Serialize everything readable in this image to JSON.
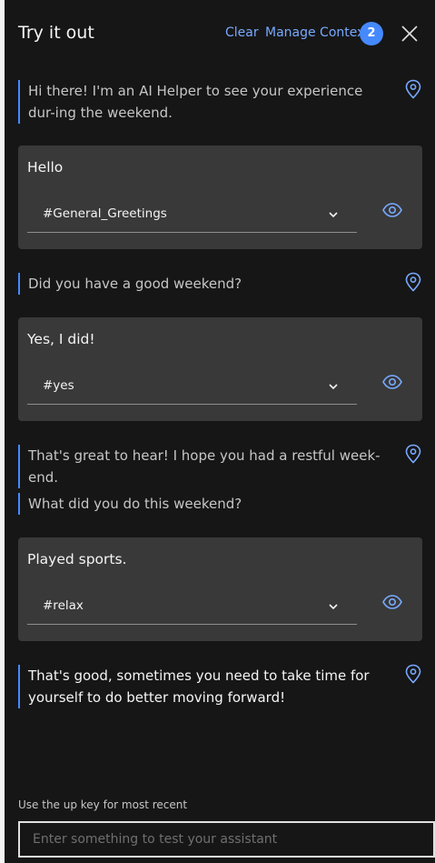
{
  "header": {
    "title": "Try it out",
    "clear_label": "Clear",
    "manage_context_label": "Manage Context",
    "context_count": "2",
    "close_icon": "close-icon"
  },
  "conversation": {
    "bot_1": "Hi there! I'm an AI Helper to see your experience dur-ing the weekend.",
    "user_1": {
      "text": "Hello",
      "intent": "#General_Greetings"
    },
    "bot_2": "Did you have a good weekend?",
    "user_2": {
      "text": "Yes, I did!",
      "intent": "#yes"
    },
    "bot_3": "That's great to hear! I hope you had a restful week-end.",
    "bot_4": "What did you do this weekend?",
    "user_3": {
      "text": "Played sports.",
      "intent": "#relax"
    },
    "bot_5": "That's good, sometimes you need to take time for yourself to do better moving forward!"
  },
  "input": {
    "hint": "Use the up key for most recent",
    "placeholder": "Enter something to test your assistant"
  },
  "icons": {
    "pin": "location-pin-icon",
    "eye": "eye-icon",
    "chevron": "chevron-down-icon"
  },
  "colors": {
    "background": "#161616",
    "card": "#393939",
    "accent": "#4589ff",
    "link": "#78a9ff",
    "text": "#f4f4f4",
    "muted_text": "#c6c6c6"
  }
}
